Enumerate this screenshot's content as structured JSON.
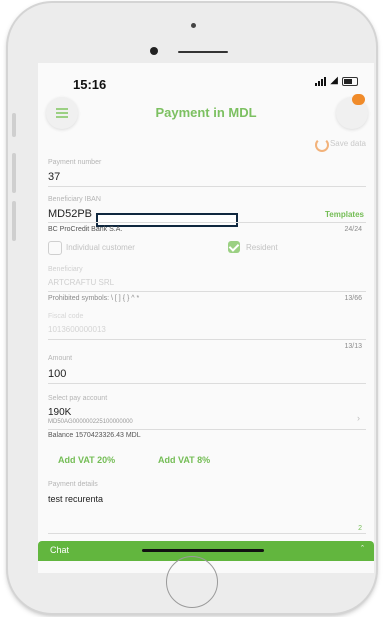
{
  "status": {
    "time": "15:16"
  },
  "header": {
    "title": "Payment in MDL"
  },
  "save_template": "Save data",
  "form": {
    "payment_number": {
      "label": "Payment number",
      "value": "37"
    },
    "beneficiary_iban": {
      "label": "Beneficiary IBAN",
      "value": "MD52PB",
      "bank": "BC ProCredit Bank S.A.",
      "counter": "24/24"
    },
    "templates_link": "Templates",
    "individual_customer": "Individual customer",
    "resident": "Resident",
    "beneficiary": {
      "label": "Beneficiary",
      "value": "ARTCRAFTU SRL"
    },
    "prohibited_symbols": "Prohibited symbols: \\ [ ] { } ^ *",
    "prohibited_counter": "13/66",
    "fiscal_code": {
      "label": "Fiscal code",
      "value": "1013600000013"
    },
    "fiscal_counter": "13/13",
    "amount": {
      "label": "Amount",
      "value": "100"
    },
    "pay_account": {
      "label": "Select pay account",
      "name": "190K",
      "number": "MD50AG000000225100000000",
      "balance": "Balance 1570423326.43 MDL"
    },
    "vat20": "Add VAT 20%",
    "vat8": "Add VAT 8%",
    "payment_details": {
      "label": "Payment details",
      "value": "test recurenta"
    },
    "details_counter": "2"
  },
  "chat": {
    "label": "Chat"
  },
  "colors": {
    "accent": "#74bd55",
    "badge": "#f08b2a",
    "chat_bar": "#62b63e"
  }
}
